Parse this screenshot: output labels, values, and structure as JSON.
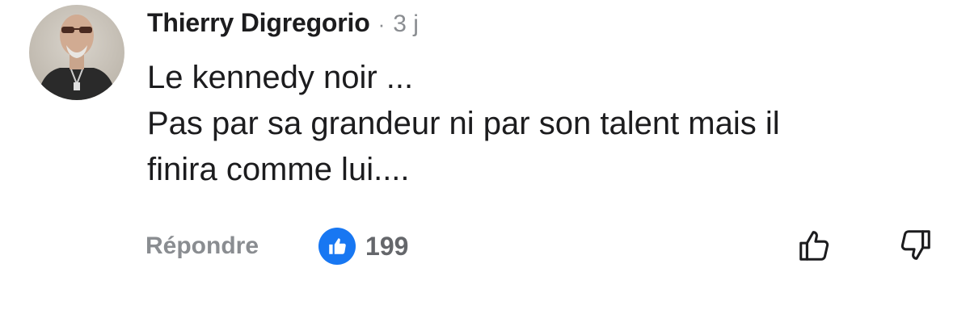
{
  "comment": {
    "author_name": "Thierry Digregorio",
    "separator": "·",
    "timestamp": "3 j",
    "text_lines": [
      "Le kennedy noir ...",
      "Pas par sa grandeur ni par son talent mais il",
      "finira comme lui...."
    ]
  },
  "actions": {
    "reply_label": "Répondre",
    "reaction_icon": "thumbs-up-icon",
    "reaction_count": "199",
    "upvote_icon": "thumbs-up-outline-icon",
    "downvote_icon": "thumbs-down-outline-icon"
  },
  "colors": {
    "like_blue": "#1877f2",
    "secondary_text": "#8a8d91",
    "primary_text": "#1c1c1e"
  }
}
